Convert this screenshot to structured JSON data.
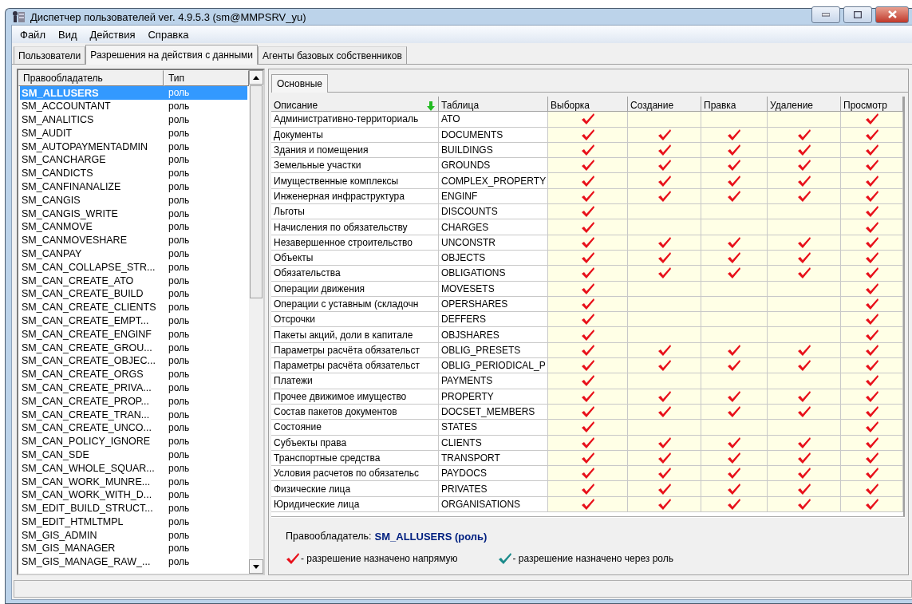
{
  "window": {
    "title": "Диспетчер пользователей  ver. 4.9.5.3 (sm@MMPSRV_yu)"
  },
  "menu": [
    {
      "label": "Файл"
    },
    {
      "label": "Вид"
    },
    {
      "label": "Действия"
    },
    {
      "label": "Справка"
    }
  ],
  "tabs": [
    {
      "label": "Пользователи",
      "selected": false
    },
    {
      "label": "Разрешения на действия с данными",
      "selected": true
    },
    {
      "label": "Агенты базовых собственников",
      "selected": false
    }
  ],
  "holders": {
    "columns": [
      "Правообладатель",
      "Тип"
    ],
    "rows": [
      {
        "name": "SM_ALLUSERS",
        "type": "роль",
        "selected": true
      },
      {
        "name": "SM_ACCOUNTANT",
        "type": "роль",
        "selected": false
      },
      {
        "name": "SM_ANALITICS",
        "type": "роль",
        "selected": false
      },
      {
        "name": "SM_AUDIT",
        "type": "роль",
        "selected": false
      },
      {
        "name": "SM_AUTOPAYMENTADMIN",
        "type": "роль",
        "selected": false
      },
      {
        "name": "SM_CANCHARGE",
        "type": "роль",
        "selected": false
      },
      {
        "name": "SM_CANDICTS",
        "type": "роль",
        "selected": false
      },
      {
        "name": "SM_CANFINANALIZE",
        "type": "роль",
        "selected": false
      },
      {
        "name": "SM_CANGIS",
        "type": "роль",
        "selected": false
      },
      {
        "name": "SM_CANGIS_WRITE",
        "type": "роль",
        "selected": false
      },
      {
        "name": "SM_CANMOVE",
        "type": "роль",
        "selected": false
      },
      {
        "name": "SM_CANMOVESHARE",
        "type": "роль",
        "selected": false
      },
      {
        "name": "SM_CANPAY",
        "type": "роль",
        "selected": false
      },
      {
        "name": "SM_CAN_COLLAPSE_STR...",
        "type": "роль",
        "selected": false
      },
      {
        "name": "SM_CAN_CREATE_ATO",
        "type": "роль",
        "selected": false
      },
      {
        "name": "SM_CAN_CREATE_BUILD",
        "type": "роль",
        "selected": false
      },
      {
        "name": "SM_CAN_CREATE_CLIENTS",
        "type": "роль",
        "selected": false
      },
      {
        "name": "SM_CAN_CREATE_EMPT...",
        "type": "роль",
        "selected": false
      },
      {
        "name": "SM_CAN_CREATE_ENGINF",
        "type": "роль",
        "selected": false
      },
      {
        "name": "SM_CAN_CREATE_GROU...",
        "type": "роль",
        "selected": false
      },
      {
        "name": "SM_CAN_CREATE_OBJEC...",
        "type": "роль",
        "selected": false
      },
      {
        "name": "SM_CAN_CREATE_ORGS",
        "type": "роль",
        "selected": false
      },
      {
        "name": "SM_CAN_CREATE_PRIVA...",
        "type": "роль",
        "selected": false
      },
      {
        "name": "SM_CAN_CREATE_PROP...",
        "type": "роль",
        "selected": false
      },
      {
        "name": "SM_CAN_CREATE_TRAN...",
        "type": "роль",
        "selected": false
      },
      {
        "name": "SM_CAN_CREATE_UNCO...",
        "type": "роль",
        "selected": false
      },
      {
        "name": "SM_CAN_POLICY_IGNORE",
        "type": "роль",
        "selected": false
      },
      {
        "name": "SM_CAN_SDE",
        "type": "роль",
        "selected": false
      },
      {
        "name": "SM_CAN_WHOLE_SQUAR...",
        "type": "роль",
        "selected": false
      },
      {
        "name": "SM_CAN_WORK_MUNRE...",
        "type": "роль",
        "selected": false
      },
      {
        "name": "SM_CAN_WORK_WITH_D...",
        "type": "роль",
        "selected": false
      },
      {
        "name": "SM_EDIT_BUILD_STRUCT...",
        "type": "роль",
        "selected": false
      },
      {
        "name": "SM_EDIT_HTMLTMPL",
        "type": "роль",
        "selected": false
      },
      {
        "name": "SM_GIS_ADMIN",
        "type": "роль",
        "selected": false
      },
      {
        "name": "SM_GIS_MANAGER",
        "type": "роль",
        "selected": false
      },
      {
        "name": "SM_GIS_MANAGE_RAW_...",
        "type": "роль",
        "selected": false
      }
    ]
  },
  "subtabs": [
    {
      "label": "Основные",
      "selected": true
    }
  ],
  "grid": {
    "columns": [
      "Описание",
      "Таблица",
      "Выборка",
      "Создание",
      "Правка",
      "Удаление",
      "Просмотр"
    ],
    "rows": [
      {
        "description": "Административно-территориаль",
        "table": "ATO",
        "perms": [
          true,
          false,
          false,
          false,
          true
        ]
      },
      {
        "description": "Документы",
        "table": "DOCUMENTS",
        "perms": [
          true,
          true,
          true,
          true,
          true
        ]
      },
      {
        "description": "Здания и помещения",
        "table": "BUILDINGS",
        "perms": [
          true,
          true,
          true,
          true,
          true
        ]
      },
      {
        "description": "Земельные участки",
        "table": "GROUNDS",
        "perms": [
          true,
          true,
          true,
          true,
          true
        ]
      },
      {
        "description": "Имущественные комплексы",
        "table": "COMPLEX_PROPERTY",
        "perms": [
          true,
          true,
          true,
          true,
          true
        ]
      },
      {
        "description": "Инженерная инфраструктура",
        "table": "ENGINF",
        "perms": [
          true,
          true,
          true,
          true,
          true
        ]
      },
      {
        "description": "Льготы",
        "table": "DISCOUNTS",
        "perms": [
          true,
          false,
          false,
          false,
          true
        ]
      },
      {
        "description": "Начисления по обязательству",
        "table": "CHARGES",
        "perms": [
          true,
          false,
          false,
          false,
          true
        ]
      },
      {
        "description": "Незавершенное строительство",
        "table": "UNCONSTR",
        "perms": [
          true,
          true,
          true,
          true,
          true
        ]
      },
      {
        "description": "Объекты",
        "table": "OBJECTS",
        "perms": [
          true,
          true,
          true,
          true,
          true
        ]
      },
      {
        "description": "Обязательства",
        "table": "OBLIGATIONS",
        "perms": [
          true,
          true,
          true,
          true,
          true
        ]
      },
      {
        "description": "Операции движения",
        "table": "MOVESETS",
        "perms": [
          true,
          false,
          false,
          false,
          true
        ]
      },
      {
        "description": "Операции с уставным (складочн",
        "table": "OPERSHARES",
        "perms": [
          true,
          false,
          false,
          false,
          true
        ]
      },
      {
        "description": "Отсрочки",
        "table": "DEFFERS",
        "perms": [
          true,
          false,
          false,
          false,
          true
        ]
      },
      {
        "description": "Пакеты акций, доли в капитале",
        "table": "OBJSHARES",
        "perms": [
          true,
          false,
          false,
          false,
          true
        ]
      },
      {
        "description": "Параметры расчёта обязательст",
        "table": "OBLIG_PRESETS",
        "perms": [
          true,
          true,
          true,
          true,
          true
        ]
      },
      {
        "description": "Параметры расчёта обязательст",
        "table": "OBLIG_PERIODICAL_P",
        "perms": [
          true,
          true,
          true,
          true,
          true
        ]
      },
      {
        "description": "Платежи",
        "table": "PAYMENTS",
        "perms": [
          true,
          false,
          false,
          false,
          true
        ]
      },
      {
        "description": "Прочее движимое имущество",
        "table": "PROPERTY",
        "perms": [
          true,
          true,
          true,
          true,
          true
        ]
      },
      {
        "description": "Состав пакетов документов",
        "table": "DOCSET_MEMBERS",
        "perms": [
          true,
          true,
          true,
          true,
          true
        ]
      },
      {
        "description": "Состояние",
        "table": "STATES",
        "perms": [
          true,
          false,
          false,
          false,
          true
        ]
      },
      {
        "description": "Субъекты права",
        "table": "CLIENTS",
        "perms": [
          true,
          true,
          true,
          true,
          true
        ]
      },
      {
        "description": "Транспортные средства",
        "table": "TRANSPORT",
        "perms": [
          true,
          true,
          true,
          true,
          true
        ]
      },
      {
        "description": "Условия расчетов по обязательс",
        "table": "PAYDOCS",
        "perms": [
          true,
          true,
          true,
          true,
          true
        ]
      },
      {
        "description": "Физические лица",
        "table": "PRIVATES",
        "perms": [
          true,
          true,
          true,
          true,
          true
        ]
      },
      {
        "description": "Юридические лица",
        "table": "ORGANISATIONS",
        "perms": [
          true,
          true,
          true,
          true,
          true
        ]
      }
    ]
  },
  "footer": {
    "label": "Правообладатель:",
    "value": "SM_ALLUSERS (роль)"
  },
  "legend": [
    {
      "kind": "direct",
      "text": "- разрешение назначено напрямую"
    },
    {
      "kind": "role",
      "text": "- разрешение назначено через роль"
    }
  ]
}
